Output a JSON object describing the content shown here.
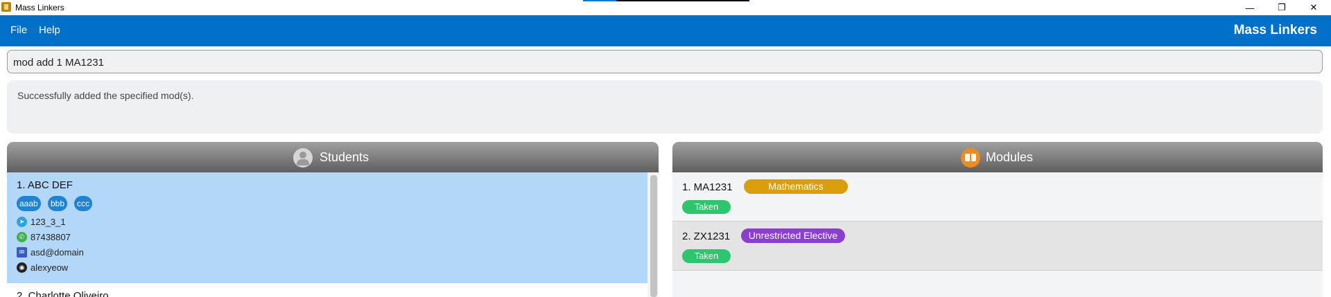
{
  "window": {
    "title": "Mass Linkers",
    "controls": {
      "minimize": "—",
      "restore": "❐",
      "close": "✕"
    }
  },
  "menu": {
    "items": [
      "File",
      "Help"
    ],
    "brand": "Mass Linkers"
  },
  "command": {
    "value": "mod add 1 MA1231"
  },
  "result": {
    "message": "Successfully added the specified mod(s)."
  },
  "students_panel": {
    "title": "Students",
    "icon": "person-icon",
    "students": [
      {
        "name": "1. ABC DEF",
        "tags": [
          "aaab",
          "bbb",
          "ccc"
        ],
        "telegram": "123_3_1",
        "phone": "87438807",
        "email": "asd@domain",
        "github": "alexyeow"
      },
      {
        "name": "2. Charlotte Oliveiro"
      }
    ]
  },
  "modules_panel": {
    "title": "Modules",
    "icon": "book-icon",
    "modules": [
      {
        "code": "1. MA1231",
        "category": "Mathematics",
        "category_color": "#d99e0a",
        "status": "Taken"
      },
      {
        "code": "2. ZX1231",
        "category": "Unrestricted Elective",
        "category_color": "#8a3fd1",
        "status": "Taken"
      }
    ]
  },
  "colors": {
    "accent": "#0070c8",
    "selected_row": "#b3d7f8",
    "tag": "#1f82d2",
    "taken": "#2ec56f"
  }
}
